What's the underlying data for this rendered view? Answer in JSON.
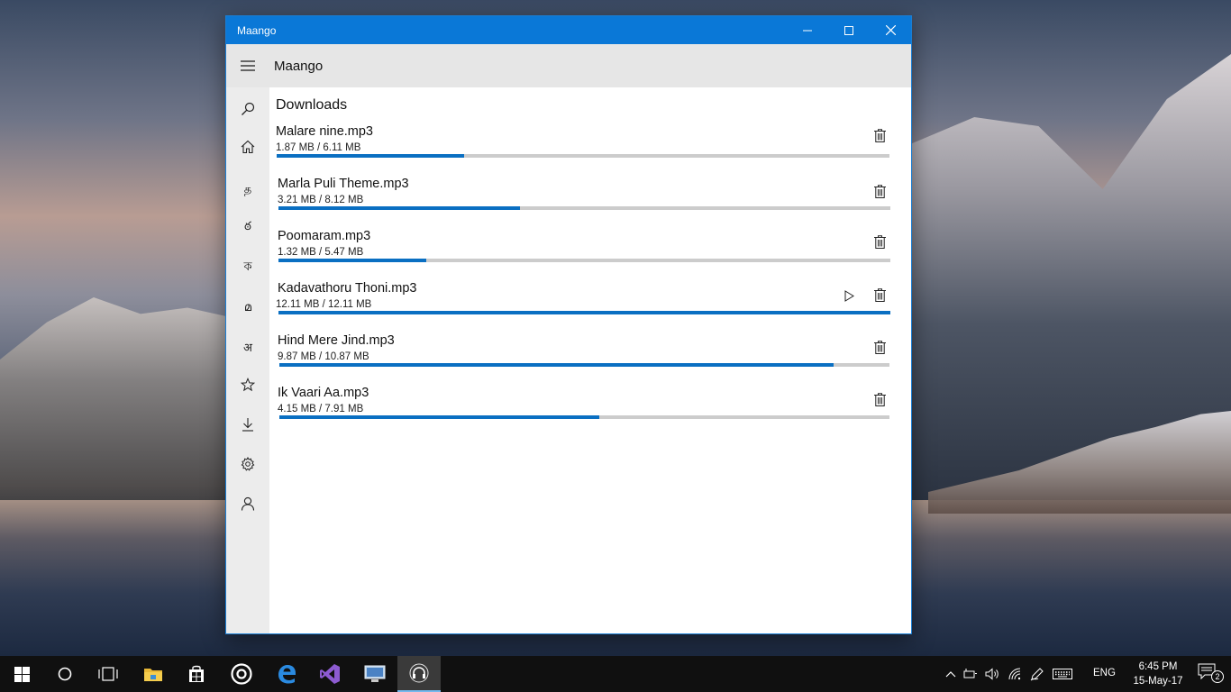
{
  "window": {
    "title": "Maango",
    "controls": [
      "minimize-icon",
      "maximize-icon",
      "close-icon"
    ]
  },
  "appbar": {
    "title": "Maango",
    "menu_icon": "hamburger-icon"
  },
  "sidenav": {
    "items": [
      {
        "name": "search",
        "icon": "search-icon"
      },
      {
        "name": "home",
        "icon": "home-icon"
      },
      {
        "name": "tamil",
        "glyph": "த"
      },
      {
        "name": "telugu",
        "glyph": "ఠ"
      },
      {
        "name": "hindi-ka",
        "glyph": "ক"
      },
      {
        "name": "malayalam",
        "glyph": "മ"
      },
      {
        "name": "hindi-a",
        "glyph": "अ"
      },
      {
        "name": "favorites",
        "icon": "star-icon"
      },
      {
        "name": "downloads",
        "icon": "download-icon"
      },
      {
        "name": "settings",
        "icon": "gear-icon"
      },
      {
        "name": "account",
        "icon": "user-icon"
      }
    ]
  },
  "page": {
    "heading": "Downloads"
  },
  "downloads": [
    {
      "name": "Malare nine.mp3",
      "size": "1.87 MB / 6.11 MB",
      "progress": 0.3061,
      "playable": false
    },
    {
      "name": "Marla Puli Theme.mp3",
      "size": "3.21 MB / 8.12 MB",
      "progress": 0.3953,
      "playable": false
    },
    {
      "name": "Poomaram.mp3",
      "size": "1.32 MB / 5.47 MB",
      "progress": 0.2413,
      "playable": false
    },
    {
      "name": "Kadavathoru Thoni.mp3",
      "size": "12.11 MB / 12.11 MB",
      "progress": 1.0,
      "playable": true
    },
    {
      "name": "Hind Mere Jind.mp3",
      "size": "9.87 MB / 10.87 MB",
      "progress": 0.908,
      "playable": false
    },
    {
      "name": "Ik Vaari Aa.mp3",
      "size": "4.15 MB / 7.91 MB",
      "progress": 0.5247,
      "playable": false
    }
  ],
  "taskbar": {
    "apps": [
      "windows-start-icon",
      "cortana-icon",
      "task-view-icon",
      "file-explorer-icon",
      "store-icon",
      "groove-icon",
      "edge-icon",
      "visual-studio-icon",
      "remote-desktop-icon",
      "maango-headphones-icon"
    ],
    "language": "ENG",
    "time": "6:45 PM",
    "date": "15-May-17",
    "notification_count": "2"
  },
  "colors": {
    "titlebar": "#0a78d7",
    "progress": "#0a6fc2",
    "track": "#cccccc"
  }
}
